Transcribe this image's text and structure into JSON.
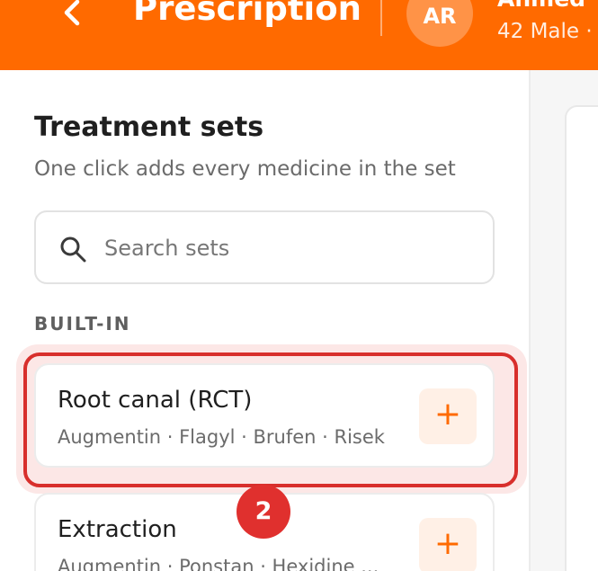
{
  "header": {
    "title": "Prescription",
    "patient": {
      "initials": "AR",
      "name": "Ahmed",
      "meta": "42 Male ·"
    }
  },
  "treatment_sets": {
    "title": "Treatment sets",
    "subtitle": "One click adds every medicine in the set",
    "search": {
      "placeholder": "Search sets",
      "value": ""
    },
    "group_label": "BUILT-IN",
    "sets": [
      {
        "name": "Root canal (RCT)",
        "medicines": "Augmentin · Flagyl · Brufen · Risek",
        "add_label": "+"
      },
      {
        "name": "Extraction",
        "medicines": "Augmentin · Ponstan · Hexidine ...",
        "add_label": "+"
      }
    ]
  },
  "annotation": {
    "step": "2"
  },
  "colors": {
    "accent": "#ff6a00",
    "highlight": "#d82f2c"
  }
}
